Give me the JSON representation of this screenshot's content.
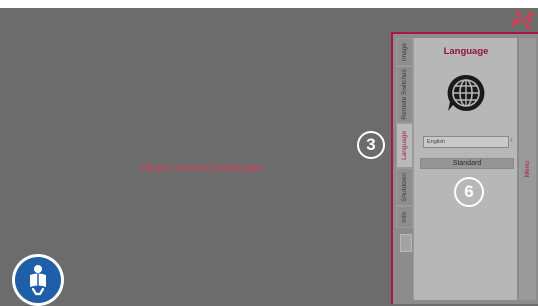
{
  "screen": {
    "message": "Please connect Endoscope."
  },
  "side_tabs": [
    {
      "label": "Image",
      "active": false
    },
    {
      "label": "Remote Switches",
      "active": false
    },
    {
      "label": "Language",
      "active": true
    },
    {
      "label": "Shutdown",
      "active": false
    },
    {
      "label": "Info",
      "active": false
    }
  ],
  "language_pane": {
    "title": "Language",
    "selected_language": "English",
    "standard_label": "Standard"
  },
  "menu": {
    "label": "Menu"
  },
  "callouts": {
    "a": "3",
    "b": "6"
  },
  "icons": {
    "logo": "pinwheel-logo-icon",
    "manual": "read-manual-icon",
    "globe": "globe-speech-icon",
    "select_arrow": "chevron-right-icon"
  },
  "colors": {
    "accent": "#a9164b",
    "message": "#d83a5a",
    "manual_button": "#1f5fa8"
  }
}
